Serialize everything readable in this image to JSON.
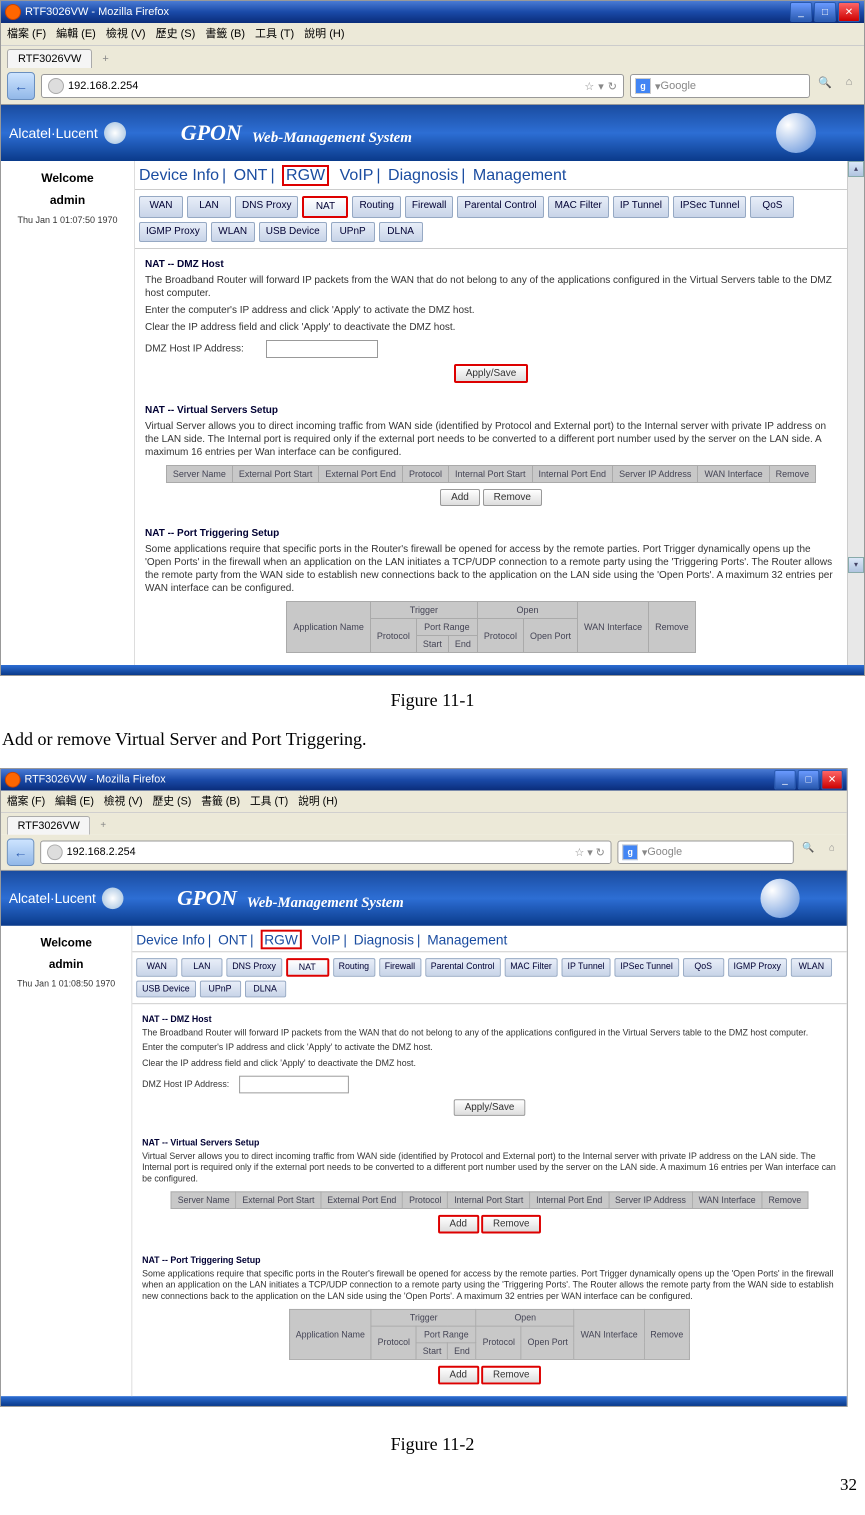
{
  "window_title": "RTF3026VW - Mozilla Firefox",
  "menu": [
    "檔案 (F)",
    "編輯 (E)",
    "檢視 (V)",
    "歷史 (S)",
    "書籤 (B)",
    "工具 (T)",
    "說明 (H)"
  ],
  "tab_label": "RTF3026VW",
  "tab_plus": "+",
  "url": "192.168.2.254",
  "search_placeholder": "Google",
  "brand": "Alcatel·Lucent",
  "gpon": "GPON",
  "banner_sub": "Web-Management System",
  "sidebar": {
    "welcome": "Welcome",
    "admin": "admin",
    "date": "Thu Jan 1 01:07:50 1970",
    "date2": "Thu Jan 1 01:08:50 1970"
  },
  "main_tabs": [
    "Device Info",
    "ONT",
    "RGW",
    "VoIP",
    "Diagnosis",
    "Management"
  ],
  "subtabs": [
    "WAN",
    "LAN",
    "DNS Proxy",
    "NAT",
    "Routing",
    "Firewall",
    "Parental Control",
    "MAC Filter",
    "IP Tunnel",
    "IPSec Tunnel",
    "QoS",
    "IGMP Proxy",
    "WLAN",
    "USB Device",
    "UPnP",
    "DLNA"
  ],
  "dmz": {
    "title": "NAT -- DMZ Host",
    "p1": "The Broadband Router will forward IP packets from the WAN that do not belong to any of the applications configured in the Virtual Servers table to the DMZ host computer.",
    "p2": "Enter the computer's IP address and click 'Apply' to activate the DMZ host.",
    "p3": "Clear the IP address field and click 'Apply' to deactivate the DMZ host.",
    "label": "DMZ Host IP Address:",
    "btn": "Apply/Save"
  },
  "vs": {
    "title": "NAT -- Virtual Servers Setup",
    "p1": "Virtual Server allows you to direct incoming traffic from WAN side (identified by Protocol and External port) to the Internal server with private IP address on the LAN side. The Internal port is required only if the external port needs to be converted to a different port number used by the server on the LAN side. A maximum 16 entries per Wan interface can be configured.",
    "cols": [
      "Server Name",
      "External Port Start",
      "External Port End",
      "Protocol",
      "Internal Port Start",
      "Internal Port End",
      "Server IP Address",
      "WAN Interface",
      "Remove"
    ],
    "add": "Add",
    "remove": "Remove"
  },
  "pt": {
    "title": "NAT -- Port Triggering Setup",
    "p1": "Some applications require that specific ports in the Router's firewall be opened for access by the remote parties. Port Trigger dynamically opens up the 'Open Ports' in the firewall when an application on the LAN initiates a TCP/UDP connection to a remote party using the 'Triggering Ports'. The Router allows the remote party from the WAN side to establish new connections back to the application on the LAN side using the 'Open Ports'. A maximum 32 entries per WAN interface can be configured.",
    "hdr": {
      "app": "Application Name",
      "trigger": "Trigger",
      "open": "Open",
      "proto": "Protocol",
      "range": "Port Range",
      "start": "Start",
      "end": "End",
      "oport": "Open Port",
      "wan": "WAN Interface",
      "remove": "Remove"
    }
  },
  "fig1": "Figure 11-1",
  "body1": "Add or remove Virtual Server and Port Triggering.",
  "fig2": "Figure 11-2",
  "page_num": "32"
}
